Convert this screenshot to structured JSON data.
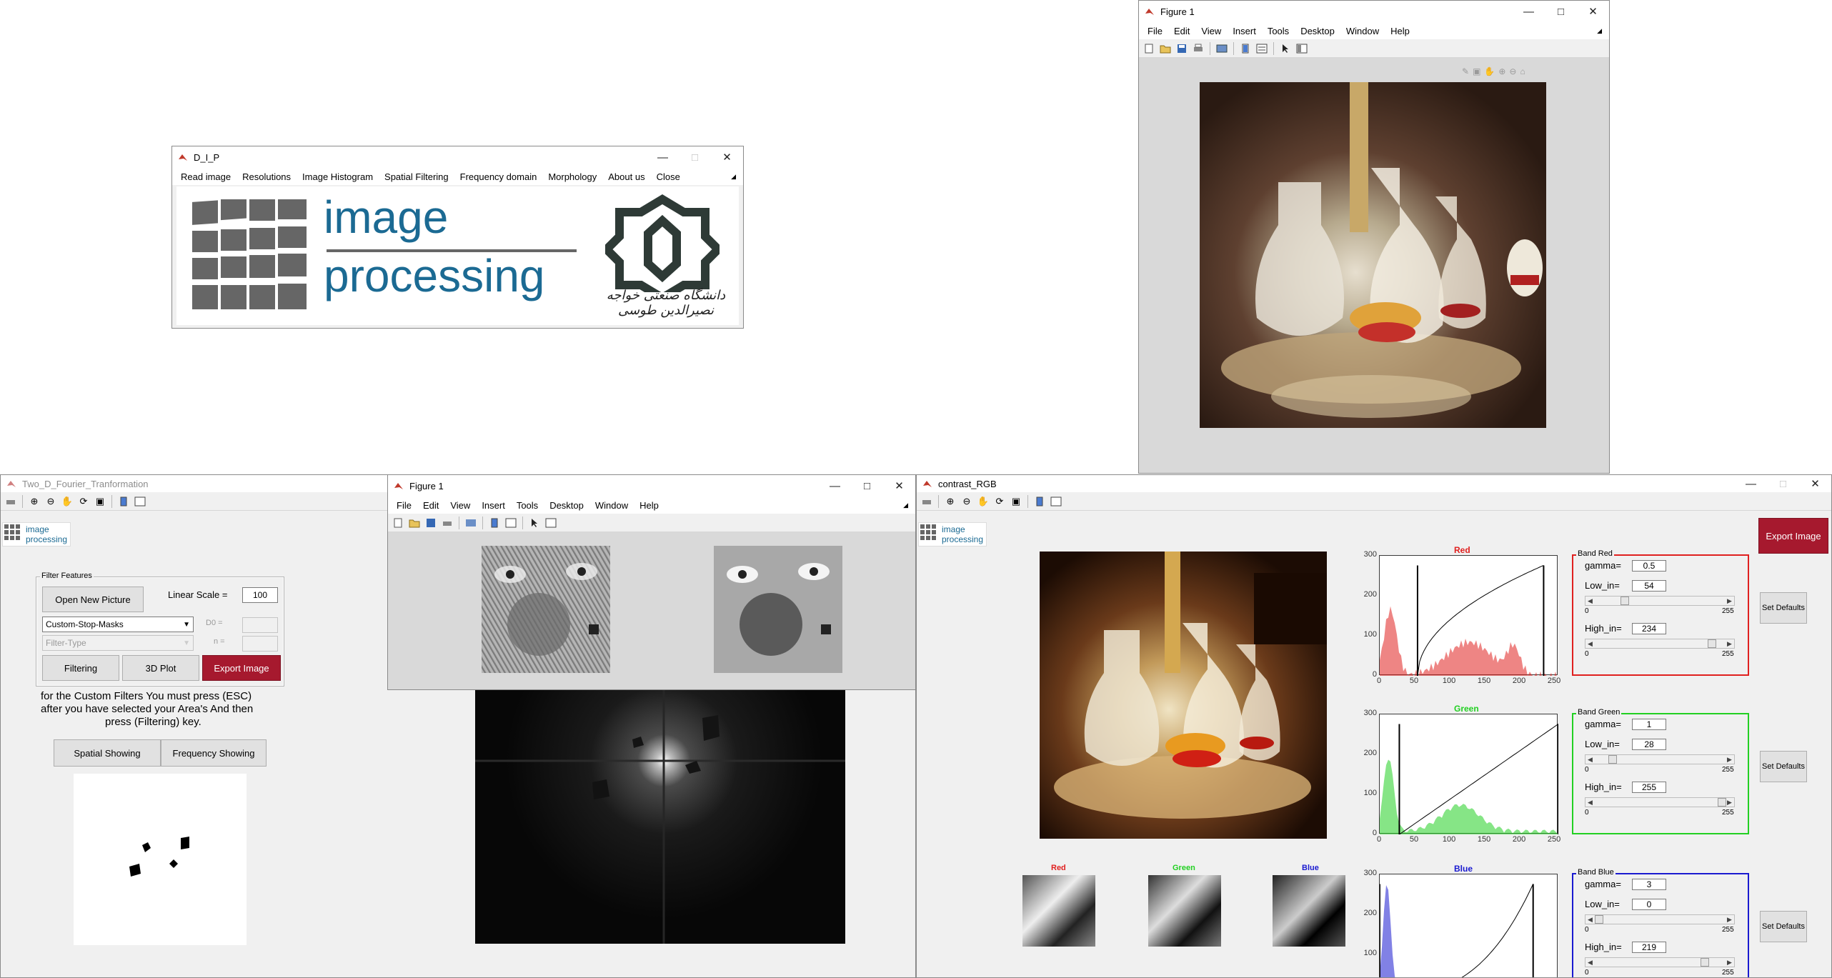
{
  "dip": {
    "title": "D_I_P",
    "menu": [
      "Read image",
      "Resolutions",
      "Image Histogram",
      "Spatial Filtering",
      "Frequency domain",
      "Morphology",
      "About us",
      "Close"
    ],
    "logo_word1": "image",
    "logo_word2": "processing",
    "university_text": "دانشگاه صنعتی خواجه نصیرالدین طوسی"
  },
  "fig_top": {
    "title": "Figure 1",
    "menu": [
      "File",
      "Edit",
      "View",
      "Insert",
      "Tools",
      "Desktop",
      "Window",
      "Help"
    ]
  },
  "fourier": {
    "title": "Two_D_Fourier_Tranformation",
    "logo_word1": "image",
    "logo_word2": "processing",
    "filter_features": "Filter Features",
    "open_new_picture": "Open New Picture",
    "linear_scale_label": "Linear Scale =",
    "linear_scale_value": "100",
    "mask_select": "Custom-Stop-Masks",
    "d0_label": "D0 =",
    "filter_type": "Filter-Type",
    "n_label": "n =",
    "filtering": "Filtering",
    "plot3d": "3D Plot",
    "export_image": "Export Image",
    "instruction_1": "for the Custom Filters You must press (ESC)",
    "instruction_2": "after you have selected your Area's And then",
    "instruction_3": "press (Filtering) key.",
    "spatial_showing": "Spatial Showing",
    "frequency_showing": "Frequency Showing"
  },
  "fig_mid": {
    "title": "Figure 1",
    "menu": [
      "File",
      "Edit",
      "View",
      "Insert",
      "Tools",
      "Desktop",
      "Window",
      "Help"
    ]
  },
  "contrast": {
    "title": "contrast_RGB",
    "logo_word1": "image",
    "logo_word2": "processing",
    "export_image": "Export Image",
    "thumb_labels": [
      "Red",
      "Green",
      "Blue"
    ],
    "bands": [
      {
        "panel_title": "Band Red",
        "hist_title": "Red",
        "color": "#e0201f",
        "gamma": "0.5",
        "low_in": "54",
        "high_in": "234",
        "set_defaults": "Set Defaults"
      },
      {
        "panel_title": "Band Green",
        "hist_title": "Green",
        "color": "#22d022",
        "gamma": "1",
        "low_in": "28",
        "high_in": "255",
        "set_defaults": "Set Defaults"
      },
      {
        "panel_title": "Band Blue",
        "hist_title": "Blue",
        "color": "#1a1ad0",
        "gamma": "3",
        "low_in": "0",
        "high_in": "219",
        "set_defaults": "Set Defaults"
      }
    ],
    "gamma_label": "gamma=",
    "low_label": "Low_in=",
    "high_label": "High_in=",
    "slider_min": "0",
    "slider_max": "255",
    "hist_yticks": [
      "300",
      "200",
      "100",
      "0"
    ],
    "hist_xticks": [
      "0",
      "50",
      "100",
      "150",
      "200",
      "250"
    ]
  },
  "chart_data": [
    {
      "type": "area",
      "title": "Red",
      "x_range": [
        0,
        255
      ],
      "ylim": [
        0,
        300
      ],
      "markers": [
        54,
        234
      ],
      "gamma": 0.5
    },
    {
      "type": "area",
      "title": "Green",
      "x_range": [
        0,
        255
      ],
      "ylim": [
        0,
        300
      ],
      "markers": [
        28,
        255
      ],
      "gamma": 1
    },
    {
      "type": "area",
      "title": "Blue",
      "x_range": [
        0,
        255
      ],
      "ylim": [
        0,
        300
      ],
      "markers": [
        0,
        219
      ],
      "gamma": 3
    }
  ],
  "colors": {
    "accent_red": "#a6192e",
    "logo_gray": "#666666",
    "logo_blue": "#1b6a93"
  }
}
